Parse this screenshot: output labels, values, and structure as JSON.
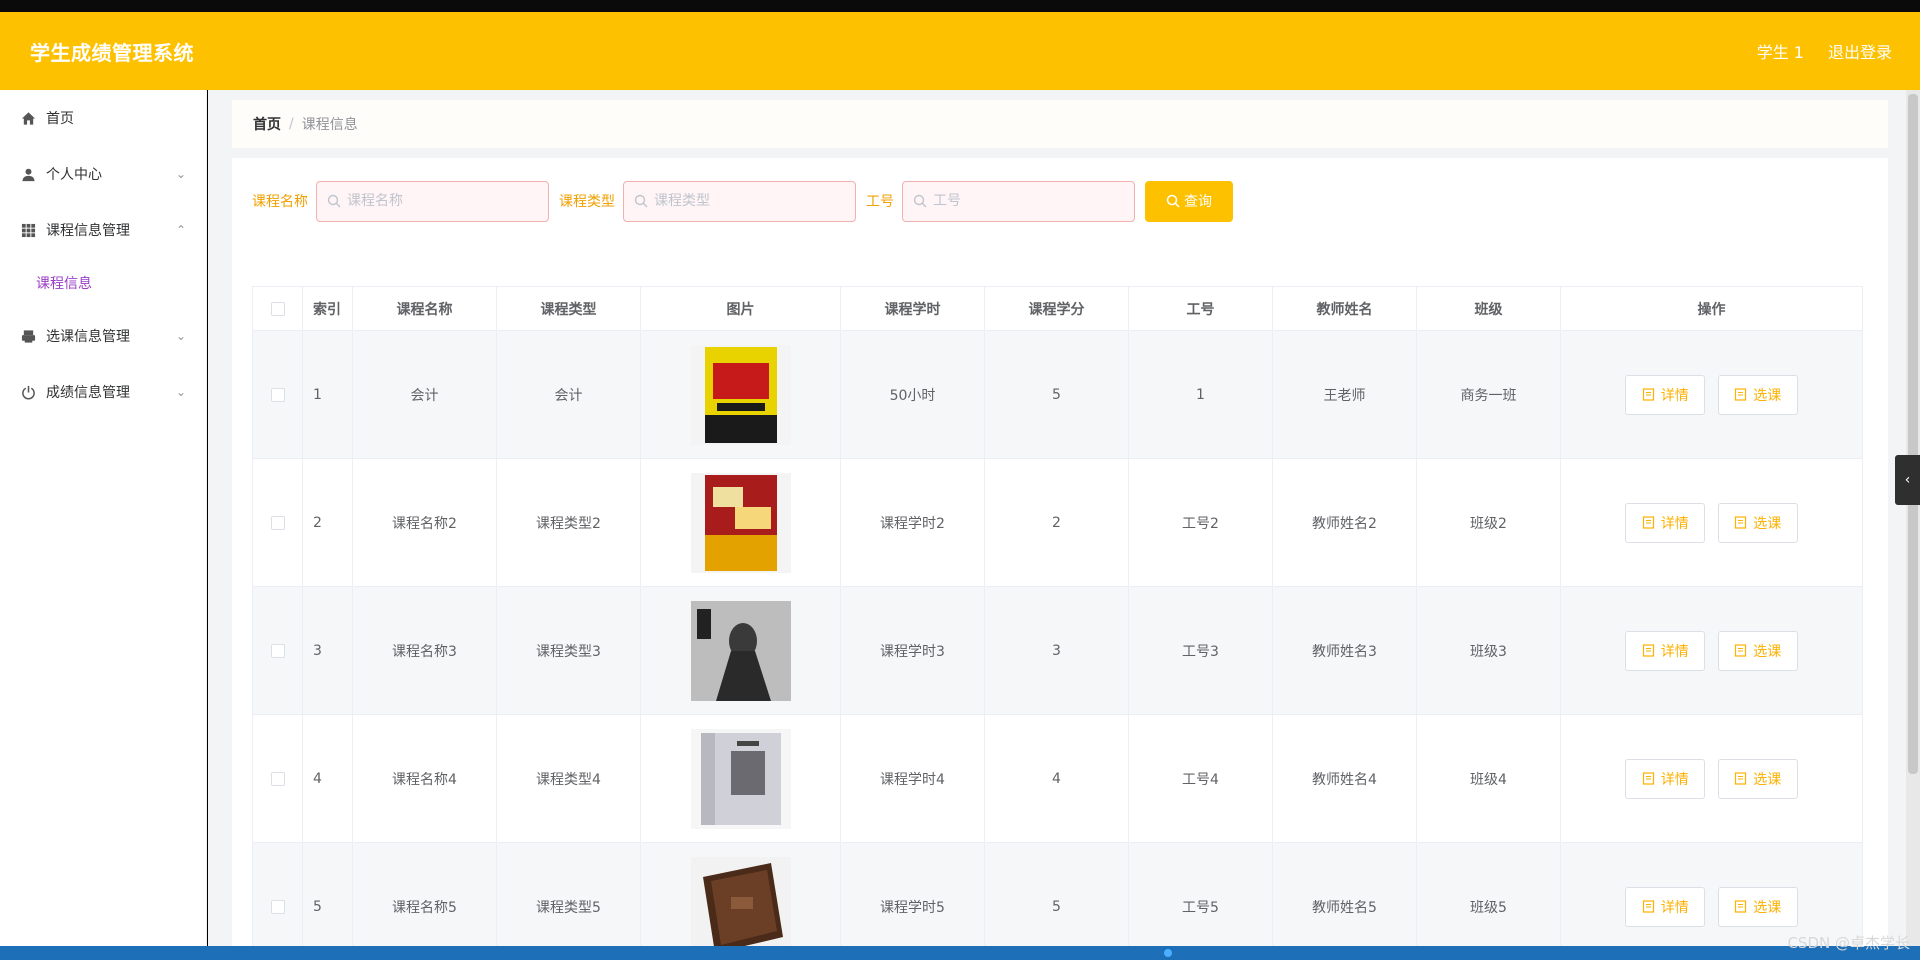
{
  "header": {
    "title": "学生成绩管理系统",
    "user": "学生 1",
    "logout": "退出登录"
  },
  "sidebar": {
    "items": [
      {
        "label": "首页",
        "icon": "home-icon"
      },
      {
        "label": "个人中心",
        "icon": "user-icon"
      },
      {
        "label": "课程信息管理",
        "icon": "grid-icon"
      },
      {
        "label": "选课信息管理",
        "icon": "printer-icon"
      },
      {
        "label": "成绩信息管理",
        "icon": "power-icon"
      }
    ],
    "submenu": {
      "label": "课程信息"
    }
  },
  "breadcrumb": {
    "home": "首页",
    "separator": "/",
    "current": "课程信息"
  },
  "search": {
    "course_name": {
      "label": "课程名称",
      "placeholder": "课程名称"
    },
    "course_type": {
      "label": "课程类型",
      "placeholder": "课程类型"
    },
    "job_no": {
      "label": "工号",
      "placeholder": "工号"
    },
    "query_label": "查询"
  },
  "table": {
    "columns": [
      "索引",
      "课程名称",
      "课程类型",
      "图片",
      "课程学时",
      "课程学分",
      "工号",
      "教师姓名",
      "班级",
      "操作"
    ],
    "rows": [
      {
        "index": "1",
        "name": "会计",
        "type": "会计",
        "hours": "50小时",
        "credits": "5",
        "job_no": "1",
        "teacher": "王老师",
        "class": "商务一班"
      },
      {
        "index": "2",
        "name": "课程名称2",
        "type": "课程类型2",
        "hours": "课程学时2",
        "credits": "2",
        "job_no": "工号2",
        "teacher": "教师姓名2",
        "class": "班级2"
      },
      {
        "index": "3",
        "name": "课程名称3",
        "type": "课程类型3",
        "hours": "课程学时3",
        "credits": "3",
        "job_no": "工号3",
        "teacher": "教师姓名3",
        "class": "班级3"
      },
      {
        "index": "4",
        "name": "课程名称4",
        "type": "课程类型4",
        "hours": "课程学时4",
        "credits": "4",
        "job_no": "工号4",
        "teacher": "教师姓名4",
        "class": "班级4"
      },
      {
        "index": "5",
        "name": "课程名称5",
        "type": "课程类型5",
        "hours": "课程学时5",
        "credits": "5",
        "job_no": "工号5",
        "teacher": "教师姓名5",
        "class": "班级5"
      }
    ],
    "detail_label": "详情",
    "select_label": "选课"
  },
  "watermark": "CSDN @卓杰学长",
  "colors": {
    "accent": "#fdc100",
    "submenu_active": "#9b3ec8"
  }
}
